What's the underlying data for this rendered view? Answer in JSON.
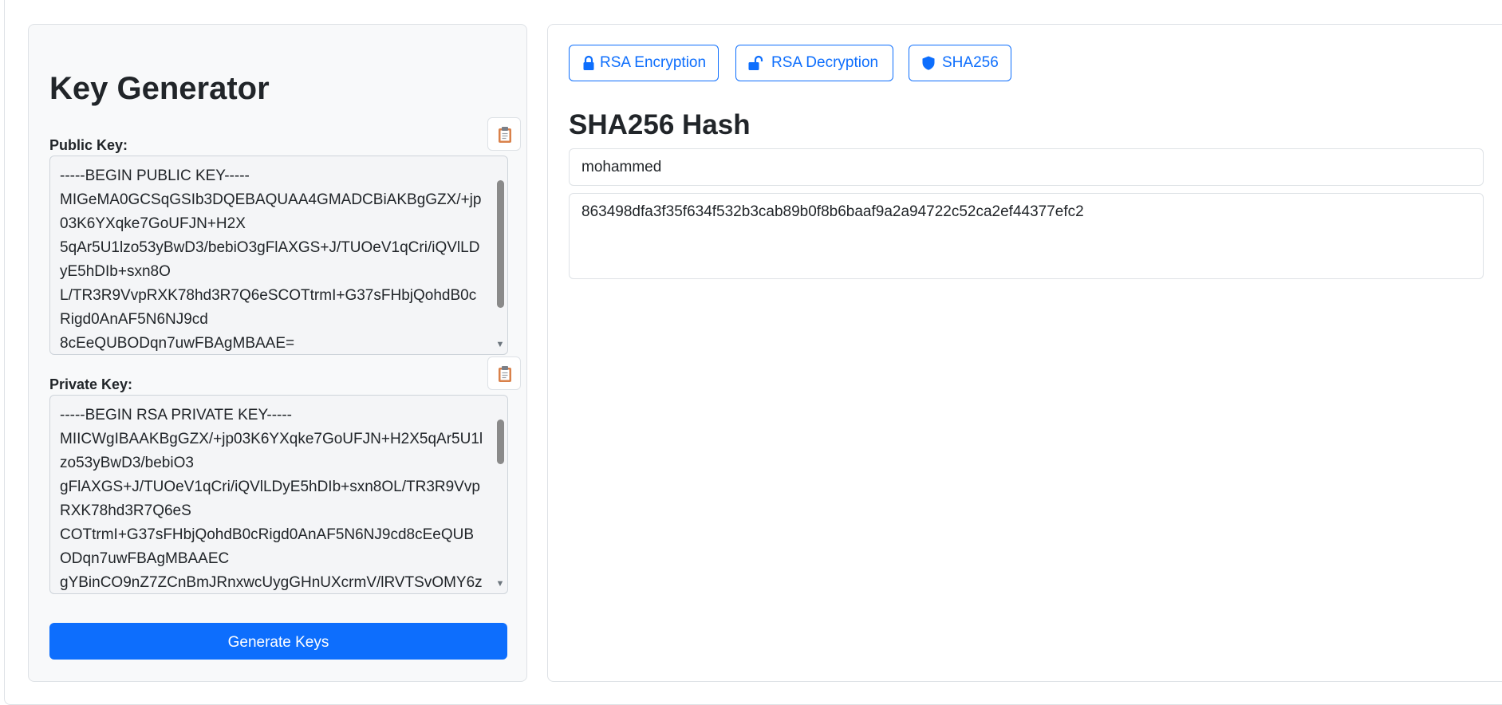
{
  "colors": {
    "primary": "#0d6efd",
    "card_bg": "#f8f9fa",
    "border": "#dee2e6",
    "clipboard_icon": "#d9814a"
  },
  "key_generator": {
    "title": "Key Generator",
    "public_key_label": "Public Key:",
    "public_key_value": "-----BEGIN PUBLIC KEY-----\nMIGeMA0GCSqGSIb3DQEBAQUAA4GMADCBiAKBgGZX/+jp03K6YXqke7GoUFJN+H2X\n5qAr5U1lzo53yBwD3/bebiO3gFlAXGS+J/TUOeV1qCri/iQVlLDyE5hDIb+sxn8O\nL/TR3R9VvpRXK78hd3R7Q6eSCOTtrmI+G37sFHbjQohdB0cRigd0AnAF5N6NJ9cd\n8cEeQUBODqn7uwFBAgMBAAE=",
    "private_key_label": "Private Key:",
    "private_key_value": "-----BEGIN RSA PRIVATE KEY-----\nMIICWgIBAAKBgGZX/+jp03K6YXqke7GoUFJN+H2X5qAr5U1lzo53yBwD3/bebiO3\ngFlAXGS+J/TUOeV1qCri/iQVlLDyE5hDIb+sxn8OL/TR3R9VvpRXK78hd3R7Q6eS\nCOTtrmI+G37sFHbjQohdB0cRigd0AnAF5N6NJ9cd8cEeQUBODqn7uwFBAgMBAAEC\ngYBinCO9nZ7ZCnBmJRnxwcUygGHnUXcrmV/lRVTSvOMY6z",
    "copy_icon": "clipboard-icon",
    "generate_label": "Generate Keys"
  },
  "tabs": [
    {
      "label": "RSA Encryption",
      "icon": "lock-icon"
    },
    {
      "label": "RSA Decryption",
      "icon": "unlock-icon"
    },
    {
      "label": "SHA256",
      "icon": "shield-icon"
    }
  ],
  "sha256": {
    "title": "SHA256 Hash",
    "input_value": "mohammed",
    "hash_value": "863498dfa3f35f634f532b3cab89b0f8b6baaf9a2a94722c52ca2ef44377efc2"
  }
}
